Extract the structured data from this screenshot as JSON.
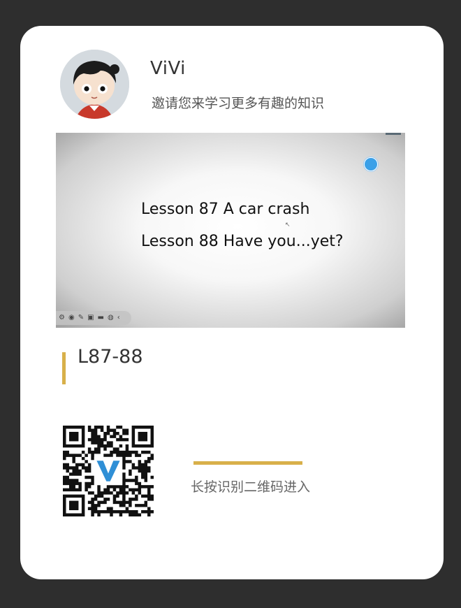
{
  "profile": {
    "name": "ViVi",
    "invite_text": "邀请您来学习更多有趣的知识"
  },
  "video": {
    "line1": "Lesson 87 A car crash",
    "line2": "Lesson 88 Have you...yet?",
    "toolbar_icons": [
      "settings-icon",
      "target-icon",
      "pen-icon",
      "select-icon",
      "screen-icon",
      "globe-icon",
      "collapse-icon"
    ],
    "record_color": "#3aa0e8"
  },
  "lesson": {
    "title": "L87-88"
  },
  "qr": {
    "hint": "长按识别二维码进入",
    "logo": "V"
  },
  "colors": {
    "background": "#2e2e2e",
    "card": "#ffffff",
    "accent": "#d8b04a"
  }
}
